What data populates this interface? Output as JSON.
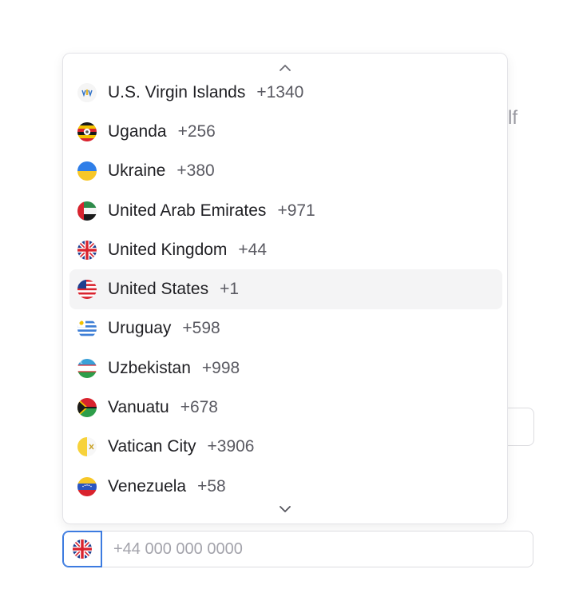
{
  "background": {
    "partial_text": "lf"
  },
  "dropdown": {
    "scroll_up_icon": "chevron-up-icon",
    "scroll_down_icon": "chevron-down-icon",
    "items": [
      {
        "name": "U.S. Virgin Islands",
        "code": "+1340",
        "flag": "vi-flag-icon"
      },
      {
        "name": "Uganda",
        "code": "+256",
        "flag": "ug-flag-icon"
      },
      {
        "name": "Ukraine",
        "code": "+380",
        "flag": "ua-flag-icon"
      },
      {
        "name": "United Arab Emirates",
        "code": "+971",
        "flag": "ae-flag-icon"
      },
      {
        "name": "United Kingdom",
        "code": "+44",
        "flag": "gb-flag-icon"
      },
      {
        "name": "United States",
        "code": "+1",
        "flag": "us-flag-icon",
        "selected": true
      },
      {
        "name": "Uruguay",
        "code": "+598",
        "flag": "uy-flag-icon"
      },
      {
        "name": "Uzbekistan",
        "code": "+998",
        "flag": "uz-flag-icon"
      },
      {
        "name": "Vanuatu",
        "code": "+678",
        "flag": "vu-flag-icon"
      },
      {
        "name": "Vatican City",
        "code": "+3906",
        "flag": "va-flag-icon"
      },
      {
        "name": "Venezuela",
        "code": "+58",
        "flag": "ve-flag-icon"
      }
    ]
  },
  "phone_field": {
    "country_flag": "gb-flag-icon",
    "placeholder": "+44 000 000 0000",
    "value": ""
  },
  "colors": {
    "focus_border": "#3c7be0",
    "selected_row_bg": "#f4f4f5",
    "placeholder": "#a3a3ab"
  }
}
